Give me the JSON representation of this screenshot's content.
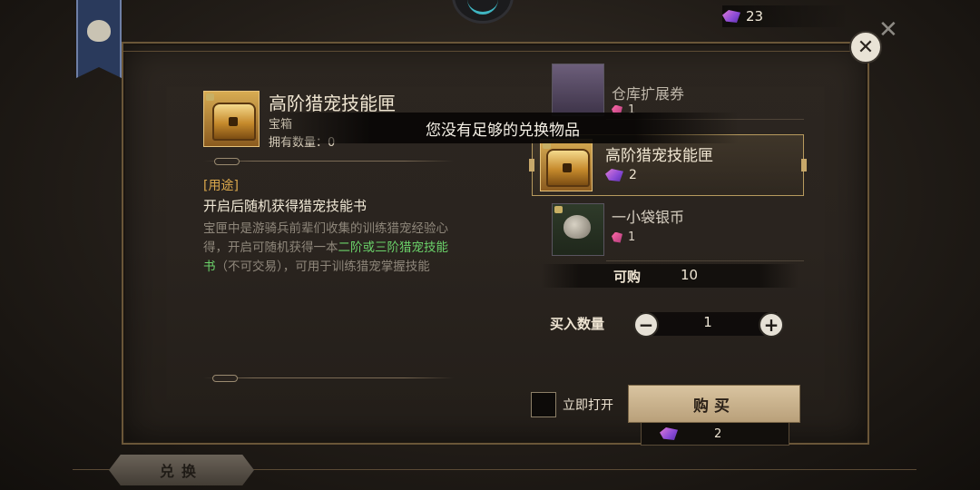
{
  "hud": {
    "currency_icon": "purple-gem-icon",
    "currency_value": "23"
  },
  "detail": {
    "title": "高阶猎宠技能匣",
    "type": "宝箱",
    "owned": "拥有数量：0",
    "usage_label": "[用途]",
    "usage_head": "开启后随机获得猎宠技能书",
    "desc_part1": "宝匣中是游骑兵前辈们收集的训练猎宠经验心得，开启可随机获得一本",
    "desc_highlight": "二阶或三阶猎宠技能书",
    "desc_part2": "（不可交易），可用于训练猎宠掌握技能"
  },
  "toast": "您没有足够的兑换物品",
  "shop_list": [
    {
      "name": "仓库扩展券",
      "cost": "1",
      "cost_icon": "red-gem-icon"
    },
    {
      "name": "高阶猎宠技能匣",
      "cost": "2",
      "cost_icon": "purple-gem-icon",
      "selected": true
    },
    {
      "name": "一小袋银币",
      "cost": "1",
      "cost_icon": "red-gem-icon"
    }
  ],
  "purchase": {
    "purchasable_label": "可购",
    "purchasable_value": "10",
    "quantity_label": "买入数量",
    "quantity_value": "1",
    "minus": "−",
    "plus": "+",
    "open_now_label": "立即打开",
    "buy_label": "购买",
    "price_value": "2"
  },
  "bottom_tab": "兑换",
  "close_symbol": "✕",
  "colors": {
    "accent_gold": "#d9a74c",
    "highlight_green": "#6bd36a",
    "panel_border": "#6a5638"
  }
}
